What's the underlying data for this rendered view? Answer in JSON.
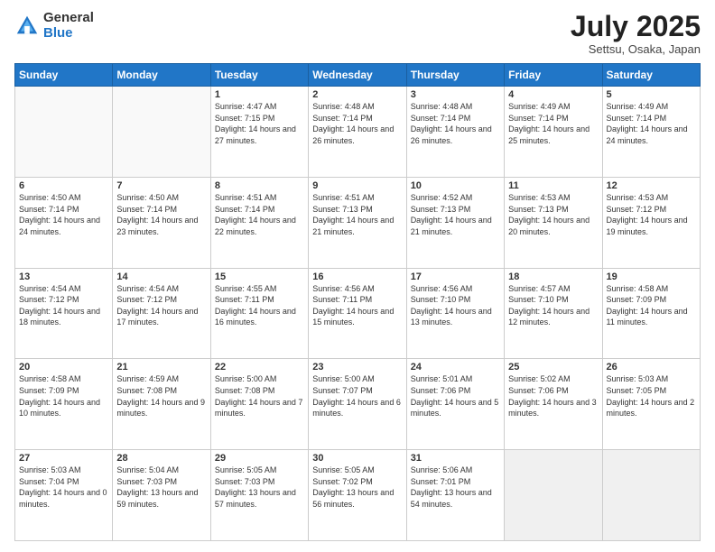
{
  "logo": {
    "general": "General",
    "blue": "Blue"
  },
  "header": {
    "month": "July 2025",
    "location": "Settsu, Osaka, Japan"
  },
  "weekdays": [
    "Sunday",
    "Monday",
    "Tuesday",
    "Wednesday",
    "Thursday",
    "Friday",
    "Saturday"
  ],
  "weeks": [
    [
      {
        "day": "",
        "sunrise": "",
        "sunset": "",
        "daylight": ""
      },
      {
        "day": "",
        "sunrise": "",
        "sunset": "",
        "daylight": ""
      },
      {
        "day": "1",
        "sunrise": "Sunrise: 4:47 AM",
        "sunset": "Sunset: 7:15 PM",
        "daylight": "Daylight: 14 hours and 27 minutes."
      },
      {
        "day": "2",
        "sunrise": "Sunrise: 4:48 AM",
        "sunset": "Sunset: 7:14 PM",
        "daylight": "Daylight: 14 hours and 26 minutes."
      },
      {
        "day": "3",
        "sunrise": "Sunrise: 4:48 AM",
        "sunset": "Sunset: 7:14 PM",
        "daylight": "Daylight: 14 hours and 26 minutes."
      },
      {
        "day": "4",
        "sunrise": "Sunrise: 4:49 AM",
        "sunset": "Sunset: 7:14 PM",
        "daylight": "Daylight: 14 hours and 25 minutes."
      },
      {
        "day": "5",
        "sunrise": "Sunrise: 4:49 AM",
        "sunset": "Sunset: 7:14 PM",
        "daylight": "Daylight: 14 hours and 24 minutes."
      }
    ],
    [
      {
        "day": "6",
        "sunrise": "Sunrise: 4:50 AM",
        "sunset": "Sunset: 7:14 PM",
        "daylight": "Daylight: 14 hours and 24 minutes."
      },
      {
        "day": "7",
        "sunrise": "Sunrise: 4:50 AM",
        "sunset": "Sunset: 7:14 PM",
        "daylight": "Daylight: 14 hours and 23 minutes."
      },
      {
        "day": "8",
        "sunrise": "Sunrise: 4:51 AM",
        "sunset": "Sunset: 7:14 PM",
        "daylight": "Daylight: 14 hours and 22 minutes."
      },
      {
        "day": "9",
        "sunrise": "Sunrise: 4:51 AM",
        "sunset": "Sunset: 7:13 PM",
        "daylight": "Daylight: 14 hours and 21 minutes."
      },
      {
        "day": "10",
        "sunrise": "Sunrise: 4:52 AM",
        "sunset": "Sunset: 7:13 PM",
        "daylight": "Daylight: 14 hours and 21 minutes."
      },
      {
        "day": "11",
        "sunrise": "Sunrise: 4:53 AM",
        "sunset": "Sunset: 7:13 PM",
        "daylight": "Daylight: 14 hours and 20 minutes."
      },
      {
        "day": "12",
        "sunrise": "Sunrise: 4:53 AM",
        "sunset": "Sunset: 7:12 PM",
        "daylight": "Daylight: 14 hours and 19 minutes."
      }
    ],
    [
      {
        "day": "13",
        "sunrise": "Sunrise: 4:54 AM",
        "sunset": "Sunset: 7:12 PM",
        "daylight": "Daylight: 14 hours and 18 minutes."
      },
      {
        "day": "14",
        "sunrise": "Sunrise: 4:54 AM",
        "sunset": "Sunset: 7:12 PM",
        "daylight": "Daylight: 14 hours and 17 minutes."
      },
      {
        "day": "15",
        "sunrise": "Sunrise: 4:55 AM",
        "sunset": "Sunset: 7:11 PM",
        "daylight": "Daylight: 14 hours and 16 minutes."
      },
      {
        "day": "16",
        "sunrise": "Sunrise: 4:56 AM",
        "sunset": "Sunset: 7:11 PM",
        "daylight": "Daylight: 14 hours and 15 minutes."
      },
      {
        "day": "17",
        "sunrise": "Sunrise: 4:56 AM",
        "sunset": "Sunset: 7:10 PM",
        "daylight": "Daylight: 14 hours and 13 minutes."
      },
      {
        "day": "18",
        "sunrise": "Sunrise: 4:57 AM",
        "sunset": "Sunset: 7:10 PM",
        "daylight": "Daylight: 14 hours and 12 minutes."
      },
      {
        "day": "19",
        "sunrise": "Sunrise: 4:58 AM",
        "sunset": "Sunset: 7:09 PM",
        "daylight": "Daylight: 14 hours and 11 minutes."
      }
    ],
    [
      {
        "day": "20",
        "sunrise": "Sunrise: 4:58 AM",
        "sunset": "Sunset: 7:09 PM",
        "daylight": "Daylight: 14 hours and 10 minutes."
      },
      {
        "day": "21",
        "sunrise": "Sunrise: 4:59 AM",
        "sunset": "Sunset: 7:08 PM",
        "daylight": "Daylight: 14 hours and 9 minutes."
      },
      {
        "day": "22",
        "sunrise": "Sunrise: 5:00 AM",
        "sunset": "Sunset: 7:08 PM",
        "daylight": "Daylight: 14 hours and 7 minutes."
      },
      {
        "day": "23",
        "sunrise": "Sunrise: 5:00 AM",
        "sunset": "Sunset: 7:07 PM",
        "daylight": "Daylight: 14 hours and 6 minutes."
      },
      {
        "day": "24",
        "sunrise": "Sunrise: 5:01 AM",
        "sunset": "Sunset: 7:06 PM",
        "daylight": "Daylight: 14 hours and 5 minutes."
      },
      {
        "day": "25",
        "sunrise": "Sunrise: 5:02 AM",
        "sunset": "Sunset: 7:06 PM",
        "daylight": "Daylight: 14 hours and 3 minutes."
      },
      {
        "day": "26",
        "sunrise": "Sunrise: 5:03 AM",
        "sunset": "Sunset: 7:05 PM",
        "daylight": "Daylight: 14 hours and 2 minutes."
      }
    ],
    [
      {
        "day": "27",
        "sunrise": "Sunrise: 5:03 AM",
        "sunset": "Sunset: 7:04 PM",
        "daylight": "Daylight: 14 hours and 0 minutes."
      },
      {
        "day": "28",
        "sunrise": "Sunrise: 5:04 AM",
        "sunset": "Sunset: 7:03 PM",
        "daylight": "Daylight: 13 hours and 59 minutes."
      },
      {
        "day": "29",
        "sunrise": "Sunrise: 5:05 AM",
        "sunset": "Sunset: 7:03 PM",
        "daylight": "Daylight: 13 hours and 57 minutes."
      },
      {
        "day": "30",
        "sunrise": "Sunrise: 5:05 AM",
        "sunset": "Sunset: 7:02 PM",
        "daylight": "Daylight: 13 hours and 56 minutes."
      },
      {
        "day": "31",
        "sunrise": "Sunrise: 5:06 AM",
        "sunset": "Sunset: 7:01 PM",
        "daylight": "Daylight: 13 hours and 54 minutes."
      },
      {
        "day": "",
        "sunrise": "",
        "sunset": "",
        "daylight": ""
      },
      {
        "day": "",
        "sunrise": "",
        "sunset": "",
        "daylight": ""
      }
    ]
  ]
}
